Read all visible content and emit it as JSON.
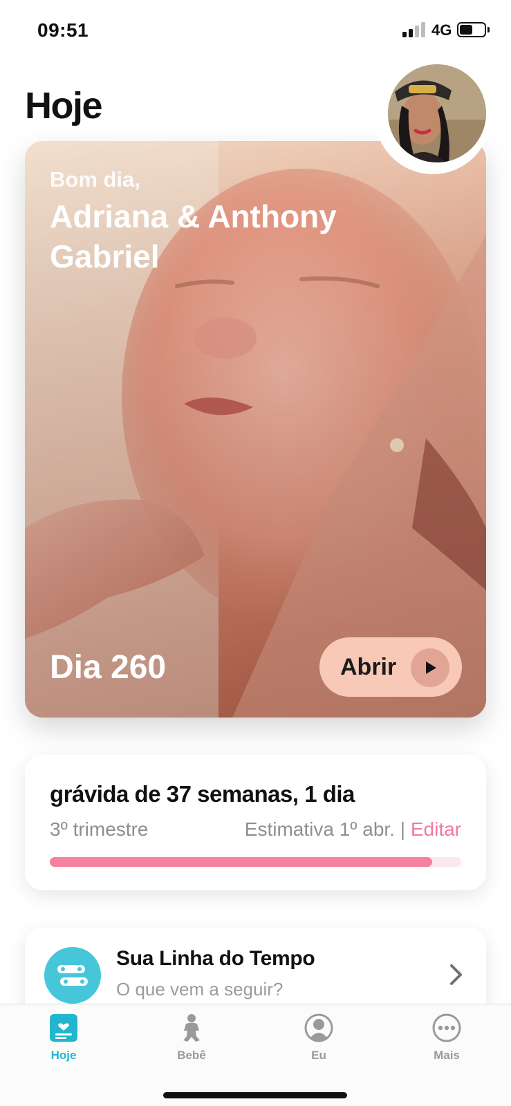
{
  "status_bar": {
    "time": "09:51",
    "network": "4G"
  },
  "page_title": "Hoje",
  "hero": {
    "greeting": "Bom dia,",
    "names": "Adriana  & Anthony Gabriel",
    "day_label": "Dia 260",
    "open_button": "Abrir"
  },
  "pregnancy": {
    "title": "grávida de 37 semanas, 1 dia",
    "trimester": "3º trimestre",
    "estimate": "Estimativa 1º abr.",
    "separator": "|",
    "edit_label": "Editar",
    "progress": 0.93
  },
  "timeline": {
    "title": "Sua Linha do Tempo",
    "subtitle": "O que vem a seguir?"
  },
  "tabs": [
    {
      "label": "Hoje",
      "icon": "today-icon",
      "active": true
    },
    {
      "label": "Bebê",
      "icon": "baby-icon",
      "active": false
    },
    {
      "label": "Eu",
      "icon": "profile-icon",
      "active": false
    },
    {
      "label": "Mais",
      "icon": "more-icon",
      "active": false
    }
  ],
  "colors": {
    "accent_teal": "#21b6cf",
    "accent_pink": "#f07aa0",
    "progress_pink": "#f5819f"
  }
}
